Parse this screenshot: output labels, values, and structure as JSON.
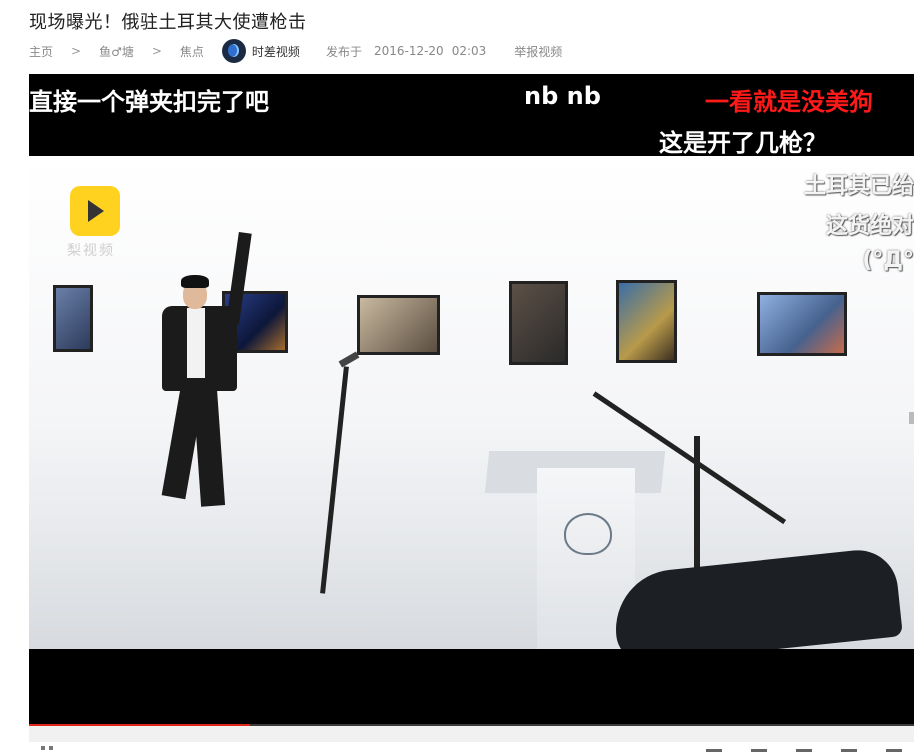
{
  "article": {
    "title": "现场曝光！俄驻土耳其大使遭枪击"
  },
  "breadcrumb": {
    "home": "主页",
    "separator": ">",
    "section": "鱼♂塘",
    "category": "焦点"
  },
  "source": {
    "channel": "时差视频",
    "published_label": "发布于",
    "published_date": "2016-12-20",
    "published_time": "02:03",
    "report_label": "举报视频"
  },
  "video": {
    "logo_text": "梨视频",
    "watermark": [
      "土耳其已绐",
      "这货绝对",
      "(°Д°"
    ],
    "danmaku": [
      "直接一个弹夹扣完了吧",
      "nb nb",
      "一看就是没美狗",
      "这是开了几枪？"
    ],
    "progress_fraction": 0.25,
    "colors": {
      "danmaku_highlight": "#ff1a1a",
      "progress": "#e1251b"
    }
  }
}
